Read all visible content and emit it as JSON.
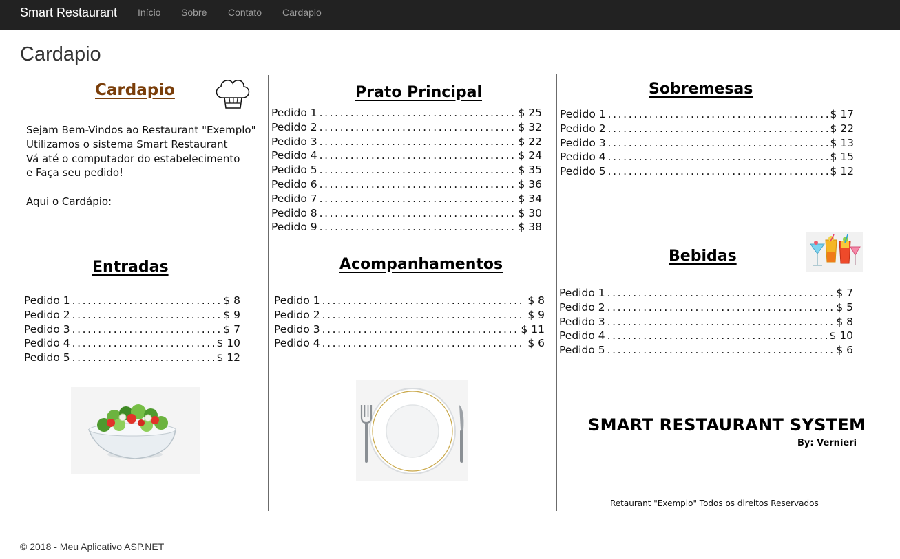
{
  "navbar": {
    "brand": "Smart Restaurant",
    "links": [
      "Início",
      "Sobre",
      "Contato",
      "Cardapio"
    ]
  },
  "page": {
    "title": "Cardapio"
  },
  "menu": {
    "heading": "Cardapio",
    "heading_color": "#7a3e0a",
    "intro": "Sejam Bem-Vindos ao Restaurant \"Exemplo\"\nUtilizamos o sistema Smart Restaurant\nVá até o computador do estabelecimento\ne Faça seu pedido!\n\nAqui o Cardápio:",
    "sections": {
      "entradas": {
        "title": "Entradas",
        "items": [
          {
            "name": "Pedido 1",
            "price": "$ 8"
          },
          {
            "name": "Pedido 2",
            "price": "$ 9"
          },
          {
            "name": "Pedido 3",
            "price": "$ 7"
          },
          {
            "name": "Pedido 4",
            "price": "$ 10"
          },
          {
            "name": "Pedido 5",
            "price": "$ 12"
          }
        ]
      },
      "prato_principal": {
        "title": "Prato Principal",
        "items": [
          {
            "name": "Pedido 1",
            "price": "$ 25"
          },
          {
            "name": "Pedido 2",
            "price": "$ 32"
          },
          {
            "name": "Pedido 3",
            "price": "$ 22"
          },
          {
            "name": "Pedido 4",
            "price": "$ 24"
          },
          {
            "name": "Pedido 5",
            "price": "$ 35"
          },
          {
            "name": "Pedido 6",
            "price": "$ 36"
          },
          {
            "name": "Pedido 7",
            "price": "$ 34"
          },
          {
            "name": "Pedido 8",
            "price": "$ 30"
          },
          {
            "name": "Pedido 9",
            "price": "$ 38"
          }
        ]
      },
      "acompanhamentos": {
        "title": "Acompanhamentos",
        "items": [
          {
            "name": "Pedido 1",
            "price": "$ 8"
          },
          {
            "name": "Pedido 2",
            "price": "$ 9"
          },
          {
            "name": "Pedido 3",
            "price": "$ 11"
          },
          {
            "name": "Pedido 4",
            "price": "$ 6"
          }
        ]
      },
      "sobremesas": {
        "title": "Sobremesas",
        "items": [
          {
            "name": "Pedido 1",
            "price": "$ 17"
          },
          {
            "name": "Pedido 2",
            "price": "$ 22"
          },
          {
            "name": "Pedido 3",
            "price": "$ 13"
          },
          {
            "name": "Pedido 4",
            "price": "$ 15"
          },
          {
            "name": "Pedido 5",
            "price": "$ 12"
          }
        ]
      },
      "bebidas": {
        "title": "Bebidas",
        "items": [
          {
            "name": "Pedido 1",
            "price": "$ 7"
          },
          {
            "name": "Pedido 2",
            "price": "$ 5"
          },
          {
            "name": "Pedido 3",
            "price": "$ 8"
          },
          {
            "name": "Pedido 4",
            "price": "$ 10"
          },
          {
            "name": "Pedido 5",
            "price": "$ 6"
          }
        ]
      }
    },
    "system_title": "SMART RESTAURANT SYSTEM",
    "system_by": "By: Vernieri",
    "rights": "Retaurant \"Exemplo\" Todos os direitos Reservados",
    "icons": {
      "chef_hat": "chef-hat-icon",
      "cocktails": "cocktails-icon",
      "salad": "salad-bowl-icon",
      "plate": "plate-cutlery-icon"
    }
  },
  "footer": {
    "copyright": "© 2018 - Meu Aplicativo ASP.NET"
  }
}
